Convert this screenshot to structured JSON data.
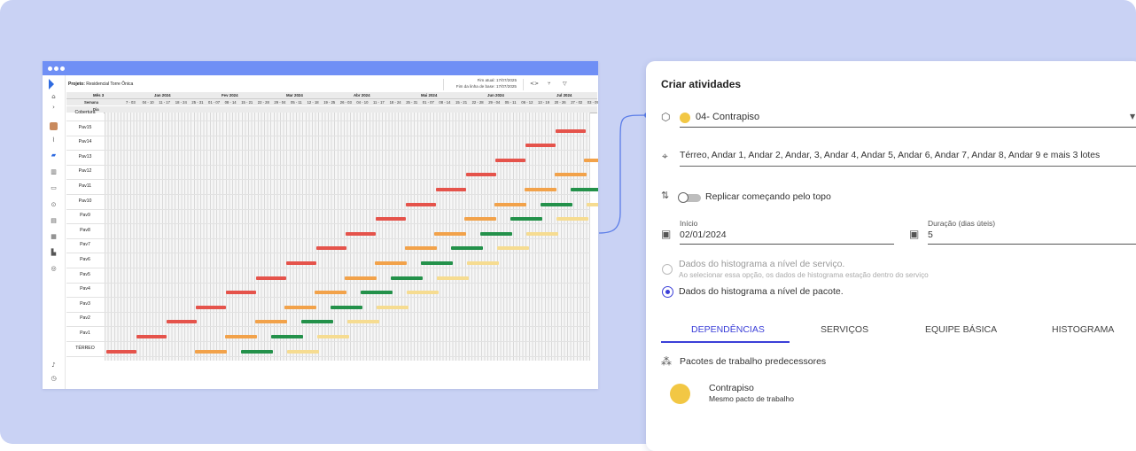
{
  "app": {
    "project_label": "Projeto:",
    "project_name": "Residencial Torre Ônica",
    "fim_atual": "Fim atual: 17/07/2025",
    "fim_linha_base": "Fim da linha de base: 17/07/2025",
    "toolbar_icons": [
      "code-icon",
      "branch-icon",
      "filter-icon"
    ],
    "header_labels": {
      "mes": "Mês 3",
      "semana": "Semana",
      "dia": "Dia"
    },
    "months": [
      "Jan 2024",
      "Fev 2024",
      "Mar 2024",
      "Abr 2024",
      "Mai 2024",
      "Jun 2024",
      "Jul 2024"
    ],
    "weeks": [
      "7 - 03",
      "04 - 10",
      "11 - 17",
      "18 - 24",
      "25 - 31",
      "01 - 07",
      "08 - 14",
      "15 - 21",
      "22 - 28",
      "29 - 04",
      "05 - 11",
      "12 - 18",
      "19 - 25",
      "26 - 03",
      "04 - 10",
      "11 - 17",
      "18 - 24",
      "25 - 31",
      "01 - 07",
      "08 - 14",
      "15 - 21",
      "22 - 28",
      "29 - 04",
      "05 - 11",
      "06 - 12",
      "13 - 19",
      "20 - 26",
      "27 - 02",
      "03 - 09",
      "1"
    ],
    "rows": [
      "Cobertura",
      "Pav15",
      "Pav14",
      "Pav13",
      "Pav12",
      "Pav11",
      "Pav10",
      "Pav9",
      "Pav8",
      "Pav7",
      "Pav6",
      "Pav5",
      "Pav4",
      "Pav3",
      "Pav2",
      "Pav1",
      "TÉRREO"
    ],
    "sidebar_icons": [
      "home-icon",
      "chevron-right-icon",
      "avatar-icon",
      "chart-line-icon",
      "trend-icon",
      "bar-chart-icon",
      "message-icon",
      "dollar-icon",
      "document-icon",
      "calendar-icon",
      "building-icon",
      "settings-icon",
      "bell-icon",
      "power-icon"
    ],
    "bar_colors": {
      "red": "#e5534b",
      "orange": "#f2a24a",
      "green": "#23914a",
      "yellow": "#f6dc91"
    },
    "titlebar_color": "#6f8ff5"
  },
  "panel": {
    "title": "Criar atividades",
    "package_value": "04- Contrapiso",
    "location_value": "Térreo, Andar 1, Andar 2, Andar, 3, Andar 4, Andar 5, Andar 6, Andar 7, Andar 8, Andar 9 e mais 3 lotes",
    "toggle_label": "Replicar começando pelo topo",
    "start_label": "Início",
    "start_value": "02/01/2024",
    "duration_label": "Duração (dias úteis)",
    "duration_value": "5",
    "radio1_label": "Dados do histograma a nível de serviço.",
    "radio1_help": "Ao selecionar essa opção, os dados de histograma estação dentro do serviço",
    "radio2_label": "Dados do histograma a nível de pacote.",
    "tabs": [
      "DEPENDÊNCIAS",
      "SERVIÇOS",
      "EQUIPE BÁSICA",
      "HISTOGRAMA"
    ],
    "active_tab": "DEPENDÊNCIAS",
    "section_label": "Pacotes de trabalho predecessores",
    "pred_name": "Contrapiso",
    "pred_sub": "Mesmo pacto de trabalho",
    "accent": "#3b3fd8",
    "package_dot_color": "#f2c744"
  }
}
